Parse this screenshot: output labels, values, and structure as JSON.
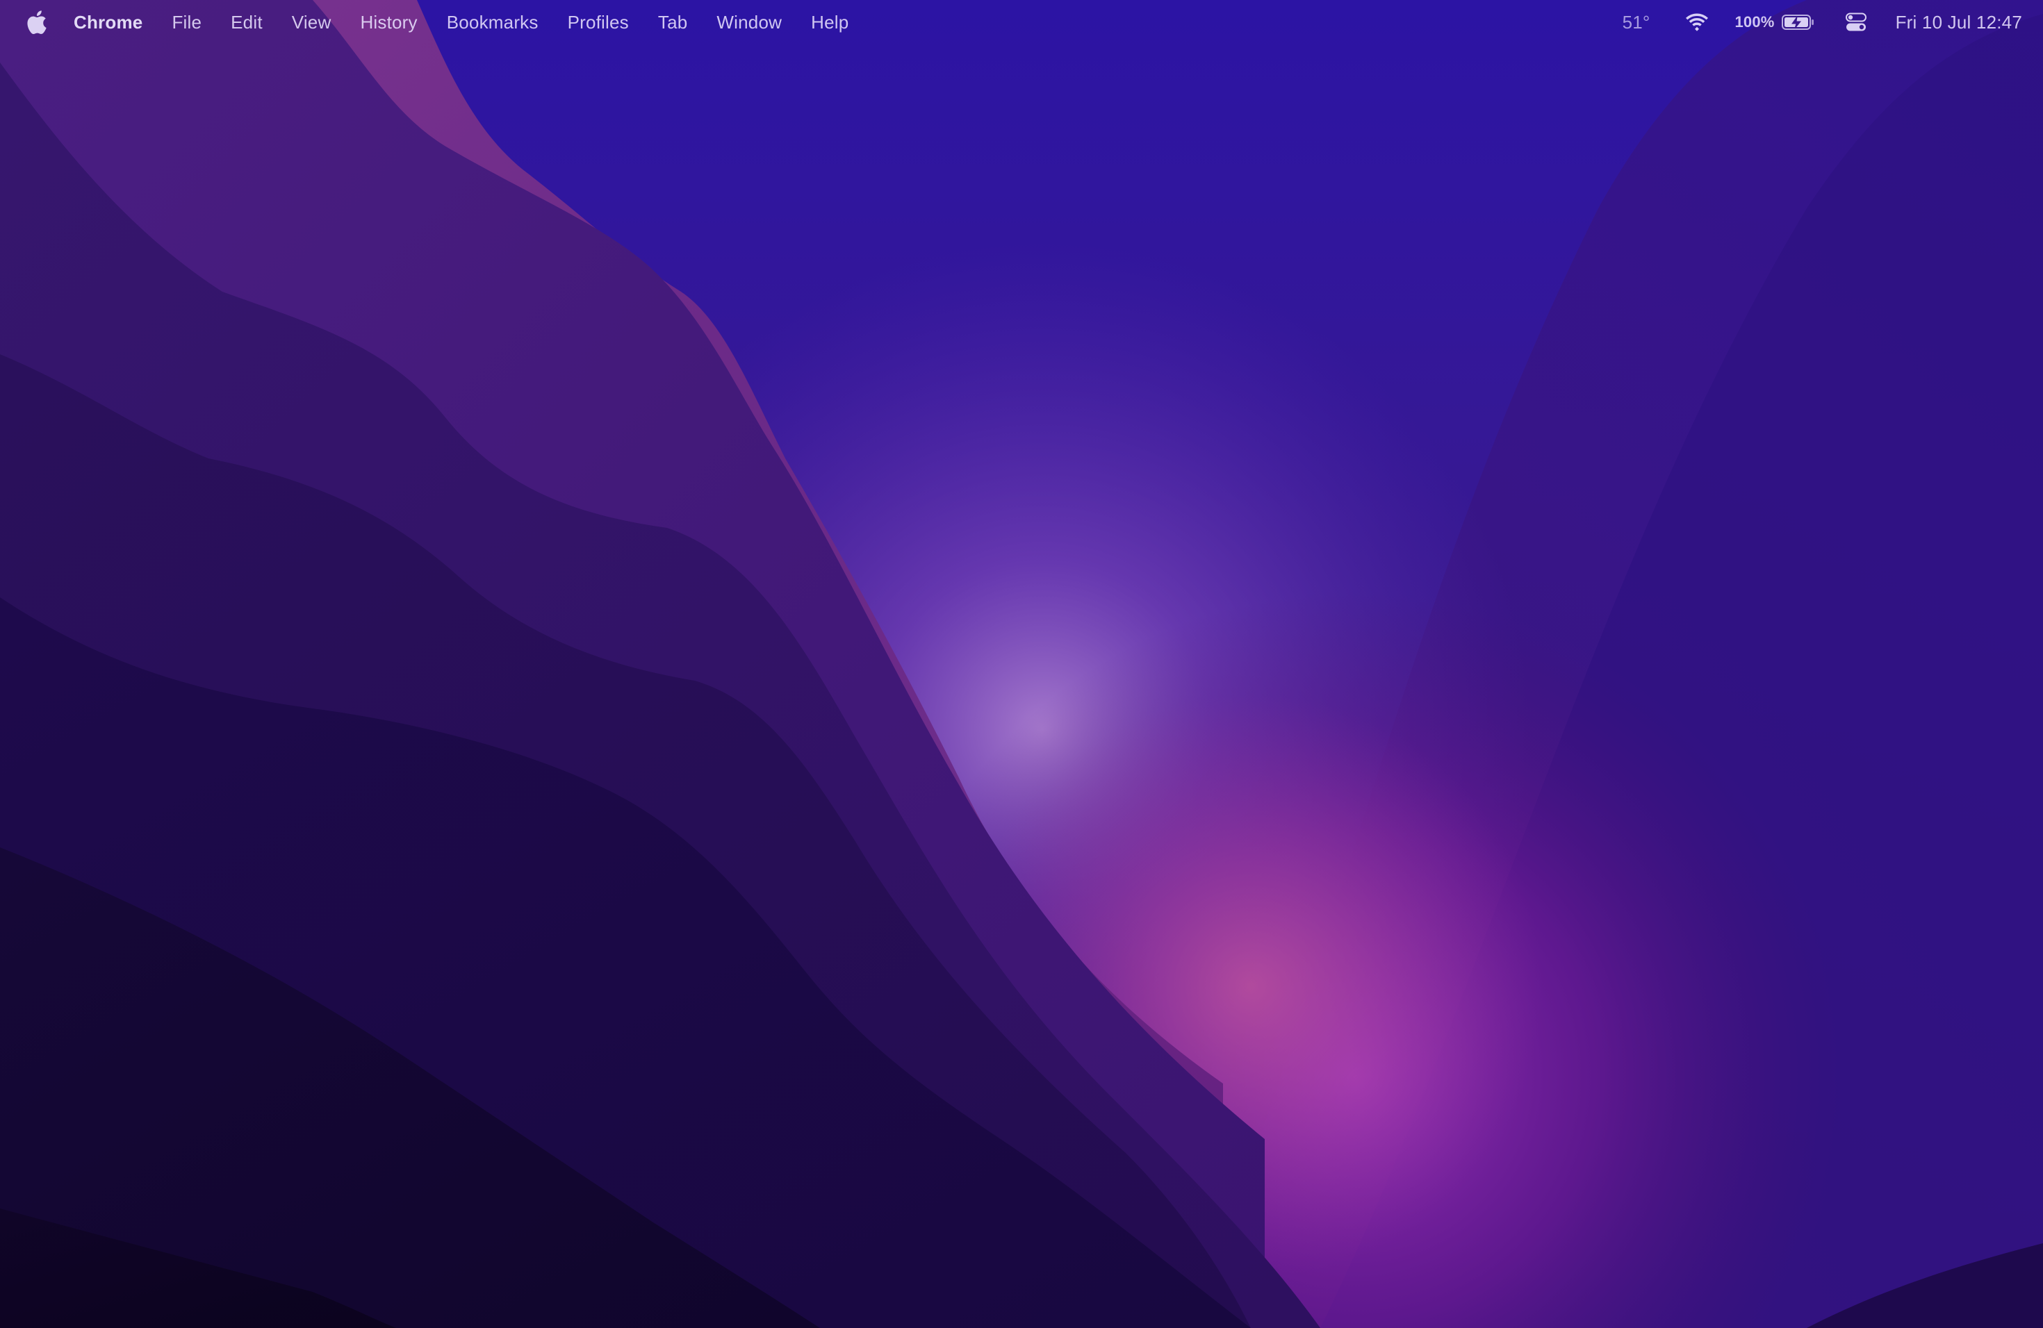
{
  "menubar": {
    "app_name": "Chrome",
    "items": [
      "File",
      "Edit",
      "View",
      "History",
      "Bookmarks",
      "Profiles",
      "Tab",
      "Window",
      "Help"
    ],
    "status": {
      "weather": "51°",
      "battery_percent": "100%",
      "datetime": "Fri 10 Jul  12:47"
    }
  },
  "icons": {
    "apple": "apple-logo-icon",
    "wifi": "wifi-icon",
    "battery": "battery-charging-icon",
    "control_center": "control-center-icon"
  },
  "colors": {
    "menubar_text": "#ebe4ff",
    "wallpaper_top": "#2e1a9e",
    "wallpaper_glow": "#c060c0",
    "wallpaper_dark": "#0d0628"
  }
}
